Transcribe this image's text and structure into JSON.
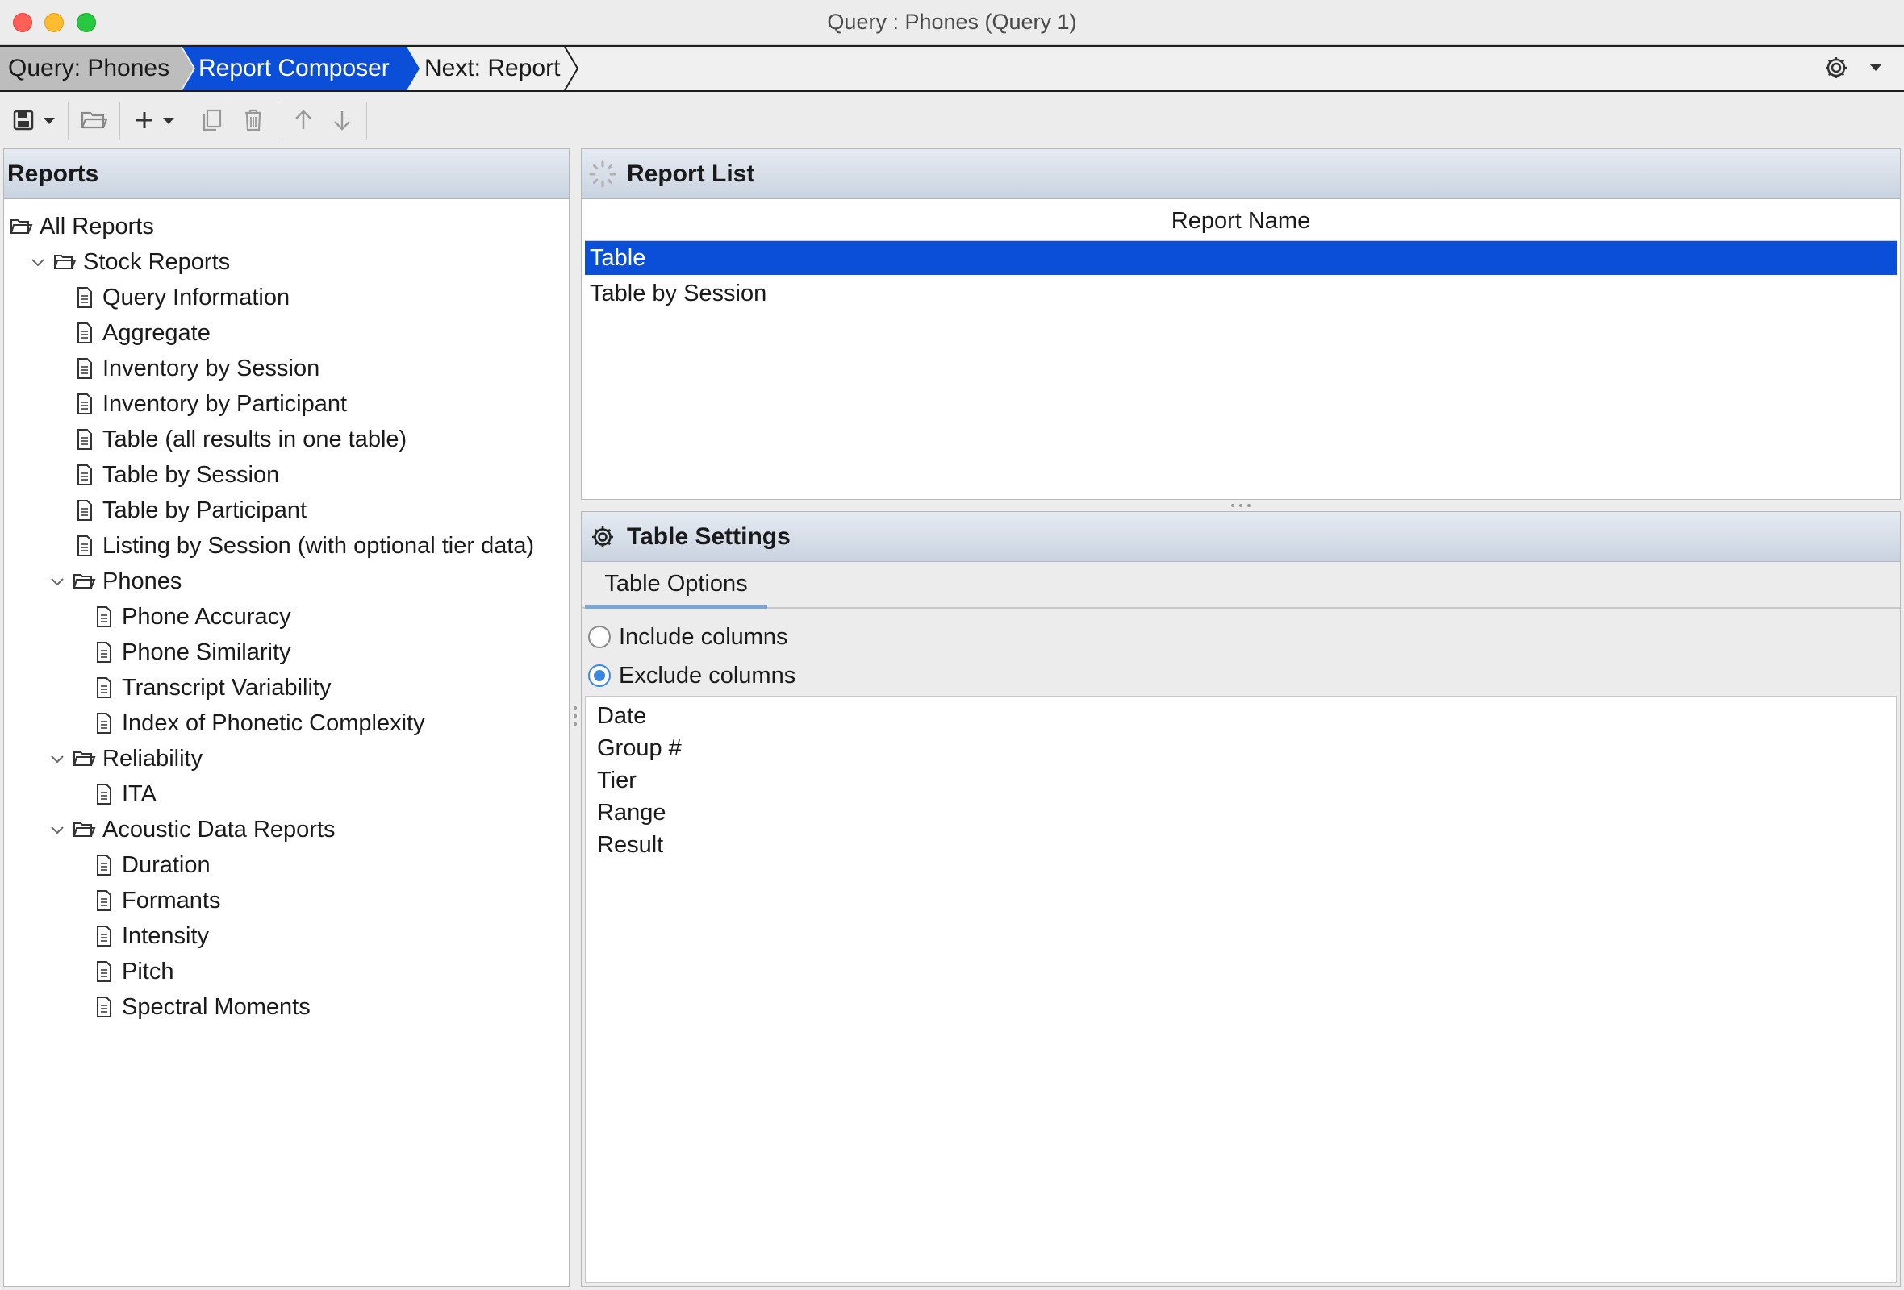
{
  "window": {
    "title": "Query : Phones (Query 1)"
  },
  "breadcrumb": {
    "items": [
      {
        "label": "Query: Phones"
      },
      {
        "label": "Report Composer"
      },
      {
        "label": "Next: Report"
      }
    ]
  },
  "toolbar": {
    "buttons": [
      "save-icon",
      "open-folder-icon",
      "add-icon",
      "copy-icon",
      "trash-icon",
      "arrow-up-icon",
      "arrow-down-icon"
    ]
  },
  "reports_panel": {
    "title": "Reports",
    "tree": [
      {
        "label": "All Reports"
      },
      {
        "label": "Stock Reports"
      },
      {
        "label": "Query Information"
      },
      {
        "label": "Aggregate"
      },
      {
        "label": "Inventory by Session"
      },
      {
        "label": "Inventory by Participant"
      },
      {
        "label": "Table (all results in one table)"
      },
      {
        "label": "Table by Session"
      },
      {
        "label": "Table by Participant"
      },
      {
        "label": "Listing by Session (with optional tier data)"
      },
      {
        "label": "Phones"
      },
      {
        "label": "Phone Accuracy"
      },
      {
        "label": "Phone Similarity"
      },
      {
        "label": "Transcript Variability"
      },
      {
        "label": "Index of Phonetic Complexity"
      },
      {
        "label": "Reliability"
      },
      {
        "label": "ITA"
      },
      {
        "label": "Acoustic Data Reports"
      },
      {
        "label": "Duration"
      },
      {
        "label": "Formants"
      },
      {
        "label": "Intensity"
      },
      {
        "label": "Pitch"
      },
      {
        "label": "Spectral Moments"
      }
    ]
  },
  "report_list": {
    "title": "Report List",
    "column_header": "Report Name",
    "rows": [
      {
        "label": "Table"
      },
      {
        "label": "Table by Session"
      }
    ]
  },
  "table_settings": {
    "title": "Table Settings",
    "tabs": [
      {
        "label": "Table Options"
      }
    ],
    "options": [
      {
        "label": "Include columns"
      },
      {
        "label": "Exclude columns"
      }
    ],
    "columns": [
      "Date",
      "Group #",
      "Tier",
      "Range",
      "Result"
    ]
  },
  "colors": {
    "selection": "#0b4fd8",
    "breadcrumb_active": "#0b4fd8",
    "breadcrumb_first": "#bdbdbd",
    "radio_accent": "#3d86e0"
  }
}
